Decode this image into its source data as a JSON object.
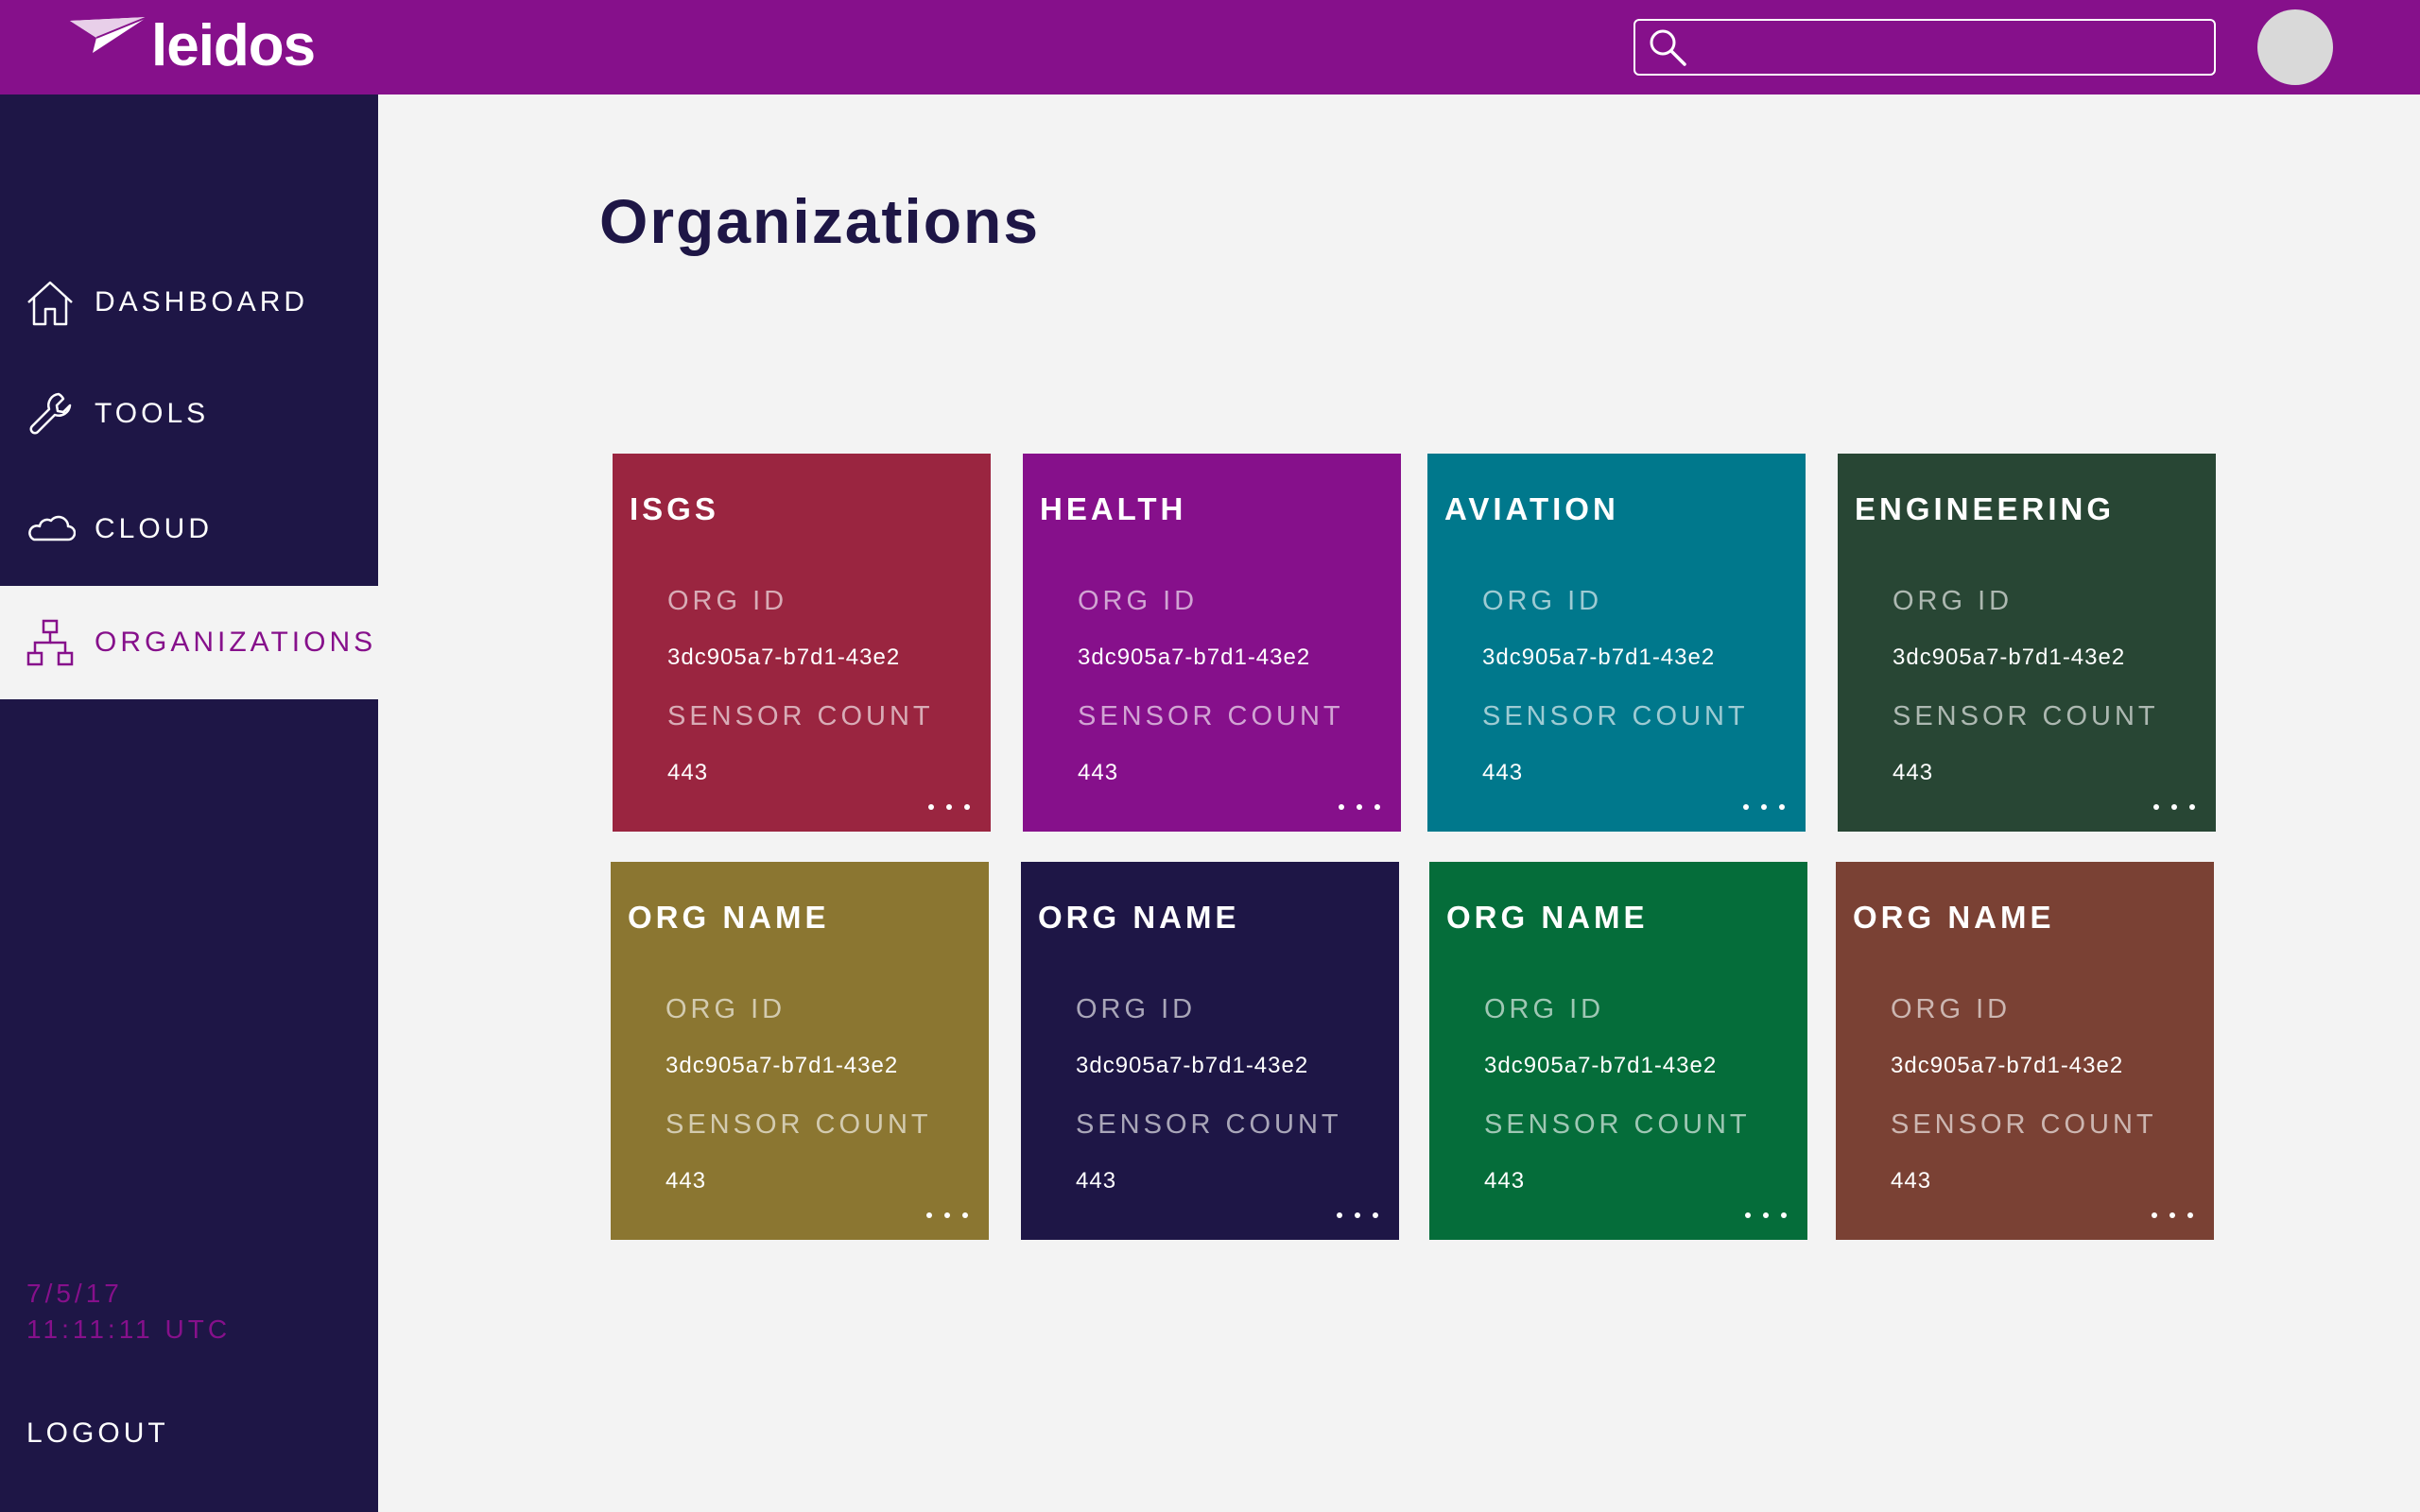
{
  "header": {
    "logo_text": "leidos",
    "search": {
      "value": "",
      "placeholder": ""
    }
  },
  "sidebar": {
    "items": [
      {
        "label": "DASHBOARD",
        "icon": "home-icon"
      },
      {
        "label": "TOOLS",
        "icon": "wrench-icon"
      },
      {
        "label": "CLOUD",
        "icon": "cloud-icon"
      },
      {
        "label": "ORGANIZATIONS",
        "icon": "org-chart-icon",
        "active": true
      }
    ],
    "date": "7/5/17",
    "time": "11:11:11 UTC",
    "logout": "LOGOUT"
  },
  "main": {
    "title": "Organizations",
    "cards": [
      {
        "name": "ISGS",
        "id_label": "ORG ID",
        "id": "3dc905a7-b7d1-43e2",
        "count_label": "SENSOR COUNT",
        "count": "443",
        "color": "#9a2540"
      },
      {
        "name": "HEALTH",
        "id_label": "ORG ID",
        "id": "3dc905a7-b7d1-43e2",
        "count_label": "SENSOR COUNT",
        "count": "443",
        "color": "#86108b"
      },
      {
        "name": "AVIATION",
        "id_label": "ORG ID",
        "id": "3dc905a7-b7d1-43e2",
        "count_label": "SENSOR COUNT",
        "count": "443",
        "color": "#00788c"
      },
      {
        "name": "ENGINEERING",
        "id_label": "ORG ID",
        "id": "3dc905a7-b7d1-43e2",
        "count_label": "SENSOR COUNT",
        "count": "443",
        "color": "#284634"
      },
      {
        "name": "ORG NAME",
        "id_label": "ORG ID",
        "id": "3dc905a7-b7d1-43e2",
        "count_label": "SENSOR COUNT",
        "count": "443",
        "color": "#8b7631"
      },
      {
        "name": "ORG NAME",
        "id_label": "ORG ID",
        "id": "3dc905a7-b7d1-43e2",
        "count_label": "SENSOR COUNT",
        "count": "443",
        "color": "#1e1646"
      },
      {
        "name": "ORG NAME",
        "id_label": "ORG ID",
        "id": "3dc905a7-b7d1-43e2",
        "count_label": "SENSOR COUNT",
        "count": "443",
        "color": "#056d3a"
      },
      {
        "name": "ORG NAME",
        "id_label": "ORG ID",
        "id": "3dc905a7-b7d1-43e2",
        "count_label": "SENSOR COUNT",
        "count": "443",
        "color": "#7a4134"
      }
    ]
  },
  "colors": {
    "brand": "#86108b",
    "sidebar": "#1e1646",
    "background": "#f3f3f3"
  }
}
